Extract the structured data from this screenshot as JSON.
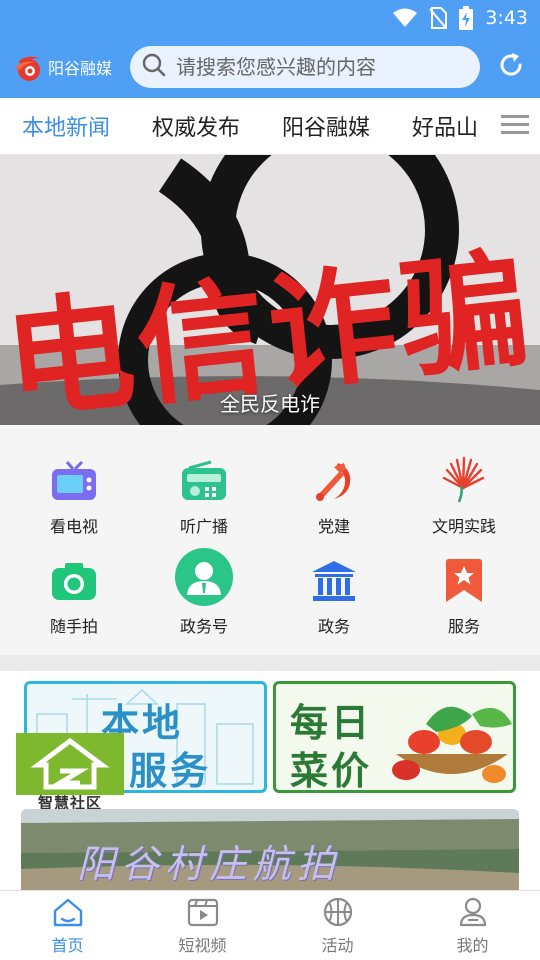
{
  "status_bar": {
    "time": "3:43"
  },
  "header": {
    "logo_text": "阳谷融媒",
    "search_placeholder": "请搜索您感兴趣的内容"
  },
  "tabs": [
    {
      "label": "本地新闻",
      "active": true
    },
    {
      "label": "权威发布",
      "active": false
    },
    {
      "label": "阳谷融媒",
      "active": false
    },
    {
      "label": "好品山",
      "active": false
    }
  ],
  "banner": {
    "caption": "全民反电诈",
    "image_text": "电信诈骗"
  },
  "grid": [
    {
      "label": "看电视",
      "icon": "tv-icon"
    },
    {
      "label": "听广播",
      "icon": "radio-icon"
    },
    {
      "label": "党建",
      "icon": "party-emblem-icon"
    },
    {
      "label": "文明实践",
      "icon": "civilization-practice-icon"
    },
    {
      "label": "随手拍",
      "icon": "camera-icon"
    },
    {
      "label": "政务号",
      "icon": "official-account-icon"
    },
    {
      "label": "政务",
      "icon": "government-building-icon"
    },
    {
      "label": "服务",
      "icon": "service-bookmark-icon"
    }
  ],
  "cards": {
    "local_service": {
      "line1": "本地",
      "line2": "服务"
    },
    "vegetable_price": {
      "line1": "每日",
      "line2": "菜价"
    },
    "community": {
      "label": "智慧社区"
    },
    "aerial": {
      "title": "阳谷村庄航拍"
    }
  },
  "bottom_nav": [
    {
      "label": "首页",
      "icon": "home-icon",
      "active": true
    },
    {
      "label": "短视频",
      "icon": "video-icon",
      "active": false
    },
    {
      "label": "活动",
      "icon": "basketball-icon",
      "active": false
    },
    {
      "label": "我的",
      "icon": "user-icon",
      "active": false
    }
  ],
  "colors": {
    "accent": "#4f9ff5",
    "active_tab": "#3c8fe8",
    "banner_red": "#e02424",
    "local_service_border": "#2bb7e0",
    "vegetable_border": "#3a9a3a"
  }
}
